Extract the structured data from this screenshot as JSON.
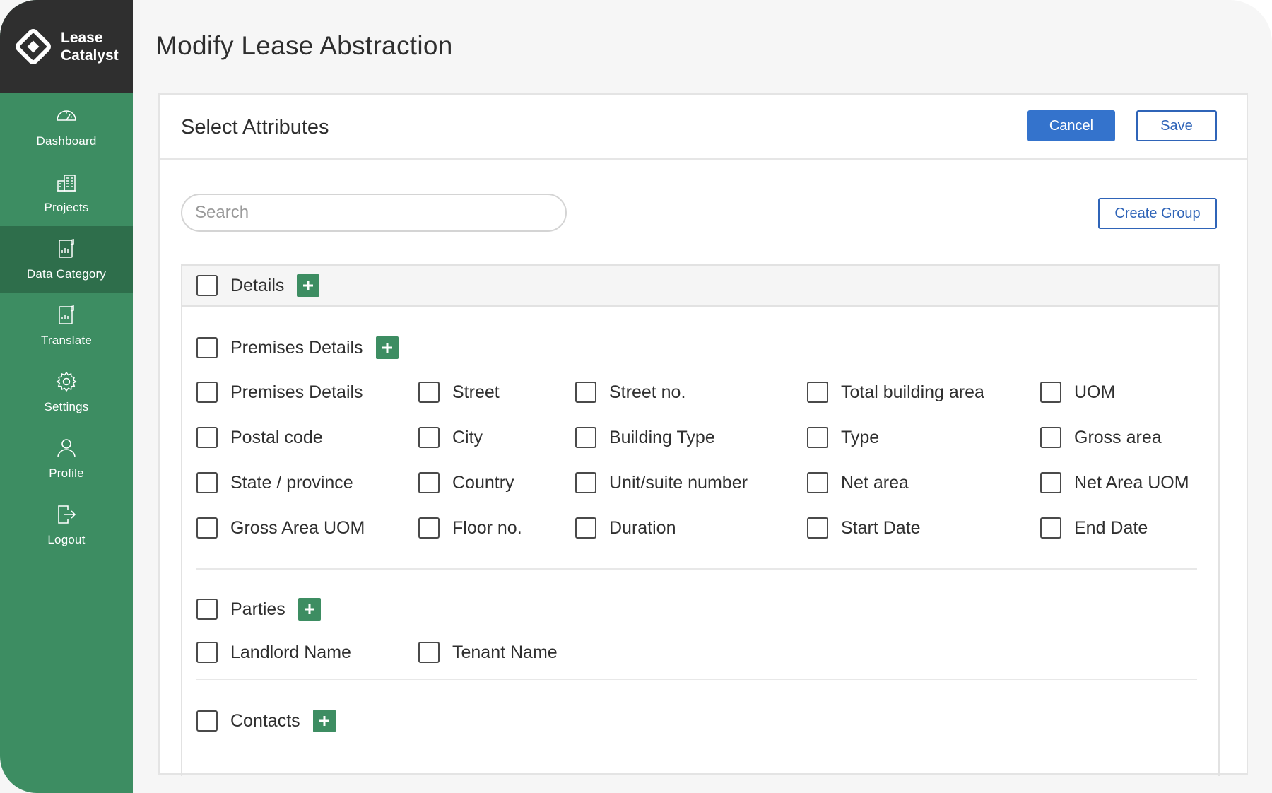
{
  "brand": {
    "line1": "Lease",
    "line2": "Catalyst"
  },
  "sidebar": {
    "items": [
      {
        "label": "Dashboard",
        "icon": "dashboard-icon",
        "active": false
      },
      {
        "label": "Projects",
        "icon": "projects-icon",
        "active": false
      },
      {
        "label": "Data Category",
        "icon": "data-category-icon",
        "active": true
      },
      {
        "label": "Translate",
        "icon": "translate-icon",
        "active": false
      },
      {
        "label": "Settings",
        "icon": "gear-icon",
        "active": false
      },
      {
        "label": "Profile",
        "icon": "user-icon",
        "active": false
      },
      {
        "label": "Logout",
        "icon": "logout-icon",
        "active": false
      }
    ]
  },
  "page": {
    "title": "Modify Lease Abstraction"
  },
  "card": {
    "title": "Select Attributes",
    "cancel_label": "Cancel",
    "save_label": "Save",
    "create_group_label": "Create Group",
    "search_placeholder": "Search"
  },
  "groups": {
    "details": {
      "label": "Details"
    },
    "premises": {
      "label": "Premises Details",
      "attributes": [
        "Premises Details",
        "Street",
        "Street no.",
        "Total building area",
        "UOM",
        "Postal code",
        "City",
        "Building Type",
        "Type",
        "Gross area",
        "State / province",
        "Country",
        "Unit/suite number",
        "Net area",
        "Net Area UOM",
        "Gross Area UOM",
        "Floor no.",
        "Duration",
        "Start Date",
        "End Date"
      ]
    },
    "parties": {
      "label": "Parties",
      "attributes": [
        "Landlord Name",
        "Tenant Name"
      ]
    },
    "contacts": {
      "label": "Contacts"
    }
  },
  "colors": {
    "sidebar": "#3d8d62",
    "sidebar_active": "#2e6e4b",
    "brand_bg": "#2f2f2f",
    "primary": "#3473cc",
    "plus": "#3d8d62"
  }
}
